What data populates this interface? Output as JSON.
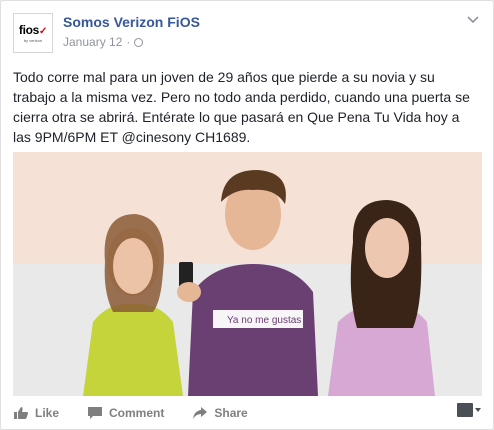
{
  "post": {
    "page_name": "Somos Verizon FiOS",
    "date": "January 12",
    "separator": "·",
    "avatar": {
      "logo_text": "fios",
      "logo_sub": "by verizon"
    },
    "text": "Todo corre mal para un joven de 29 años que pierde a su novia y su trabajo a la misma vez. Pero no todo anda perdido, cuando una puerta se cierra otra se abrirá. Entérate lo que pasará en Que Pena Tu Vida hoy a las 9PM/6PM ET @cinesony CH1689.",
    "image": {
      "shirt_text": "Ya no me gustas"
    }
  },
  "actions": {
    "like": "Like",
    "comment": "Comment",
    "share": "Share"
  },
  "colors": {
    "link": "#365899",
    "muted": "#90949c",
    "text": "#1d2129",
    "fios_red": "#cd040b"
  },
  "icons": [
    "chevron-down-icon",
    "globe-icon",
    "like-icon",
    "comment-icon",
    "share-icon",
    "viewer-avatar-icon"
  ]
}
